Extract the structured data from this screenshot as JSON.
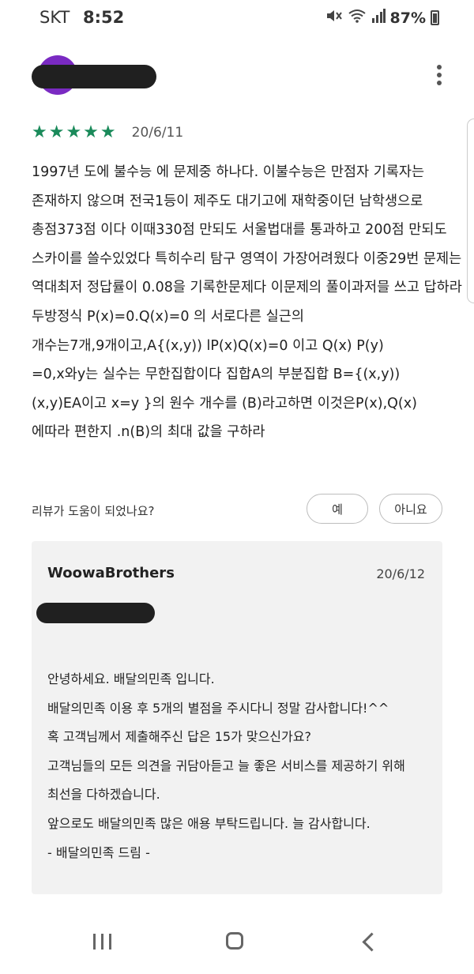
{
  "status_bar": {
    "carrier": "SKT",
    "time": "8:52",
    "battery": "87%",
    "icons": [
      "mute-icon",
      "wifi-icon",
      "signal-icon",
      "battery-icon"
    ]
  },
  "review": {
    "date": "20/6/11",
    "stars": "★★★★★",
    "rating": 5,
    "lines": [
      "1997년 도에 불수능 에 문제중 하나다. 이불수능은 만점자 기록자는",
      "존재하지 않으며 전국1등이 제주도 대기고에 재학중이던 남학생으로",
      "총점373점 이다 이때330점 만되도 서울법대를 통과하고 200점 만되도",
      "스카이를 쓸수있었다 특히수리 탐구 영역이 가장어려웠다 이중29번 문제는",
      "역대최저 정답률이 0.08을 기록한문제다 이문제의 풀이과저믈 쓰고 답하라",
      "두방정식 P(x)=0.Q(x)=0 의 서로다른 실근의",
      "개수는7개,9개이고,A{(x,y)) lP(x)Q(x)=0 이고 Q(x) P(y)",
      "=0,x와y는 실수는 무한집합이다 집합A의 부분집합 B={(x,y))",
      "(x,y)EA이고 x=y }의 원수 개수를 (B)라고하면 이것은P(x),Q(x)",
      "에따라 편한지 .n(B)의 최대 값을 구하라"
    ]
  },
  "helpful": {
    "question": "리뷰가 도움이 되었나요?",
    "yes_label": "예",
    "no_label": "아니요"
  },
  "reply": {
    "developer": "WoowaBrothers",
    "date": "20/6/12",
    "lines": [
      "안녕하세요. 배달의민족 입니다.",
      "배달의민족 이용 후 5개의 별점을 주시다니 정말 감사합니다!^^",
      "혹 고객님께서 제출해주신 답은 15가 맞으신가요?",
      "고객님들의 모든 의견을 귀담아듣고 늘 좋은 서비스를 제공하기 위해",
      "최선을 다하겠습니다.",
      "앞으로도 배달의민족 많은 애용 부탁드립니다. 늘 감사합니다.",
      "- 배달의민족 드림 -"
    ]
  },
  "nav": {
    "icons": [
      "recents-icon",
      "home-icon",
      "back-icon"
    ]
  },
  "colors": {
    "star": "#1a8a5a",
    "avatar": "#7a2ac2",
    "card_bg": "#f2f2f2"
  }
}
